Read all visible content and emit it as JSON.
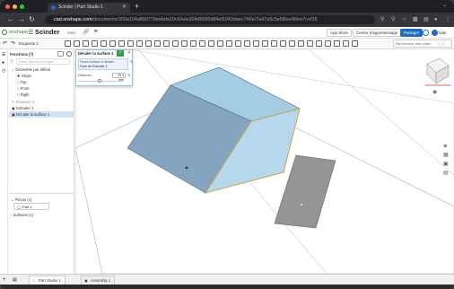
{
  "browser": {
    "tab_title": "Scinder | Part Studio 1",
    "url_host": "cad.onshape.com",
    "url_path": "/documents/300a104af66f778eebda10c6/w/e304d5690d84ef1043daec74f/e/7a47a9c5e5f6ee96ee7cef26"
  },
  "app": {
    "brand": "onshape",
    "doc_title": "Scinder",
    "branch": "Main",
    "app_store": "App Store",
    "learning_center": "Centre d'apprentissage",
    "share": "Partager",
    "user": "Ivan",
    "search_tools": "Rechercher des outils...",
    "search_shortcut": "⌥ C"
  },
  "feature_panel": {
    "title": "Fonctions (7)",
    "filter_placeholder": "Filtrer par nom ou type",
    "default_geometry": "Géométrie par défaut",
    "origin": "Origin",
    "planes": [
      "Top",
      "Front",
      "Right"
    ],
    "rollback": "Esquisse 1",
    "extrude": "Extruder 1",
    "selected_feature": "Décaler la surface 1",
    "parts_header": "Pièces (1)",
    "part_name": "Part 1",
    "surfaces_header": "Surfaces (1)"
  },
  "dialog": {
    "title": "Décaler la surface 1",
    "face_field": "Faces surface à décaler",
    "face_value": "Face de Extruder 1",
    "distance_label": "Distance",
    "distance_value": "25.4 mm"
  },
  "bottom": {
    "tab_part_studio": "Part Studio 1",
    "tab_assembly": "Assembly 1"
  },
  "colors": {
    "accent": "#1c6bc4",
    "cube_top": "#9fc9e0",
    "cube_left": "#7fa0bd",
    "cube_front": "#b6d8ec",
    "surface": "#8a8a8a",
    "plane": "#7f96ad",
    "selected_row": "#cfe3f7"
  },
  "icons": {
    "checkmark": "✓",
    "close": "✕",
    "plus": "+"
  }
}
